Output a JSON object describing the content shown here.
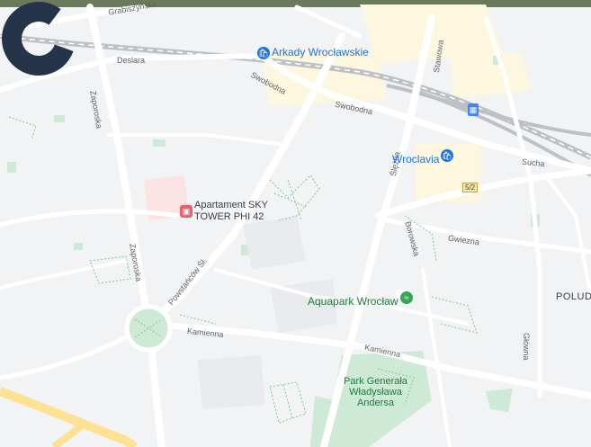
{
  "map": {
    "colors": {
      "land": "#f1f3f4",
      "road": "#ffffff",
      "major_road": "#fde293",
      "commercial": "#fef7e0",
      "park": "#ceead6",
      "park_path": "#81c995",
      "rail": "#bdc1c6",
      "water_pool": "#ffffff"
    },
    "streets": {
      "grabiszynska": "Grabiszyńska",
      "deslara": "Deslara",
      "zaporoska_north": "Zaporoska",
      "zaporoska_south": "Zaporoska",
      "swobodna_1": "Swobodna",
      "swobodna_2": "Swobodna",
      "slezna": "Ślężna",
      "borowska": "Borowska",
      "gwiezna": "Gwiezna",
      "sucha": "Sucha",
      "powstancow": "Powstańców Śl.",
      "kamienna_w": "Kamienna",
      "kamienna_e": "Kamienna",
      "glowna": "Główna",
      "stawowa": "Stawowa"
    },
    "pois": {
      "arkady": "Arkady Wrocławskie",
      "wroclavia": "Wroclavia",
      "aquapark": "Aquapark Wrocław",
      "hotel_line1": "Apartament SKY",
      "hotel_line2": "TOWER PHI 42",
      "park_line1": "Park Generała",
      "park_line2": "Władysława",
      "park_line3": "Andersa",
      "district": "POLUDN"
    },
    "road_shield": "5/2",
    "icons": {
      "mall": "shopping-bag-icon",
      "train": "train-icon",
      "pool": "swimming-icon",
      "hotel": "bed-icon",
      "loader": "loading-spinner-icon"
    }
  }
}
